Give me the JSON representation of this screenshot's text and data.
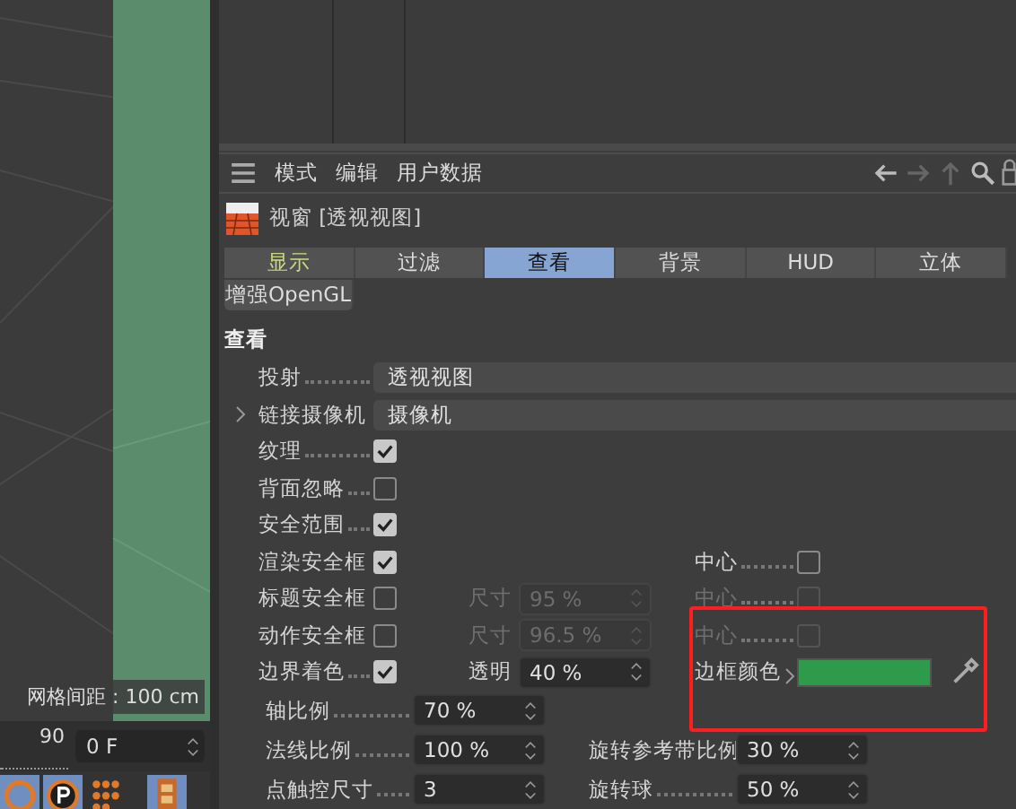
{
  "viewport": {
    "grid_label": "网格间距 : 100 cm",
    "ruler_mark": "90",
    "frame_field": "0 F"
  },
  "menu": {
    "items": [
      "模式",
      "编辑",
      "用户数据"
    ]
  },
  "object": {
    "title": "视窗 [透视视图]"
  },
  "tabs": [
    {
      "label": "显示",
      "selected": false,
      "modified": true
    },
    {
      "label": "过滤",
      "selected": false,
      "modified": false
    },
    {
      "label": "查看",
      "selected": true,
      "modified": false
    },
    {
      "label": "背景",
      "selected": false,
      "modified": false
    },
    {
      "label": "HUD",
      "selected": false,
      "modified": false
    },
    {
      "label": "立体",
      "selected": false,
      "modified": false
    }
  ],
  "subtabs": [
    {
      "label": "增强OpenGL",
      "selected": false
    }
  ],
  "section": "查看",
  "properties": [
    {
      "kind": "dropdown",
      "label": "投射",
      "value": "透视视图"
    },
    {
      "kind": "link",
      "label": "链接摄像机",
      "value": "摄像机",
      "expanded": false
    },
    {
      "kind": "check",
      "label": "纹理",
      "checked": true
    },
    {
      "kind": "check",
      "label": "背面忽略",
      "checked": false
    },
    {
      "kind": "check",
      "label": "安全范围",
      "checked": true
    },
    {
      "kind": "check",
      "label": "渲染安全框",
      "checked": true,
      "center": {
        "label": "中心",
        "checked": false,
        "disabled": false
      }
    },
    {
      "kind": "check",
      "label": "标题安全框",
      "checked": false,
      "size": {
        "label": "尺寸",
        "value": "95 %",
        "disabled": true
      },
      "center": {
        "label": "中心",
        "checked": false,
        "disabled": true
      }
    },
    {
      "kind": "check",
      "label": "动作安全框",
      "checked": false,
      "size": {
        "label": "尺寸",
        "value": "96.5 %",
        "disabled": true
      },
      "center": {
        "label": "中心",
        "checked": false,
        "disabled": true
      }
    },
    {
      "kind": "check",
      "label": "边界着色",
      "checked": true,
      "size": {
        "label": "透明",
        "value": "40 %",
        "disabled": false
      },
      "border_color": {
        "label": "边框颜色",
        "color": "#2e9a4b"
      }
    }
  ],
  "numeric_rows": [
    [
      {
        "label": "轴比例",
        "value": "70 %"
      }
    ],
    [
      {
        "label": "法线比例",
        "value": "100 %"
      },
      {
        "label": "旋转参考带比例",
        "value": "30 %"
      }
    ],
    [
      {
        "label": "点触控尺寸",
        "value": "3"
      },
      {
        "label": "旋转球",
        "value": "50 %"
      }
    ]
  ],
  "highlight_box": true
}
